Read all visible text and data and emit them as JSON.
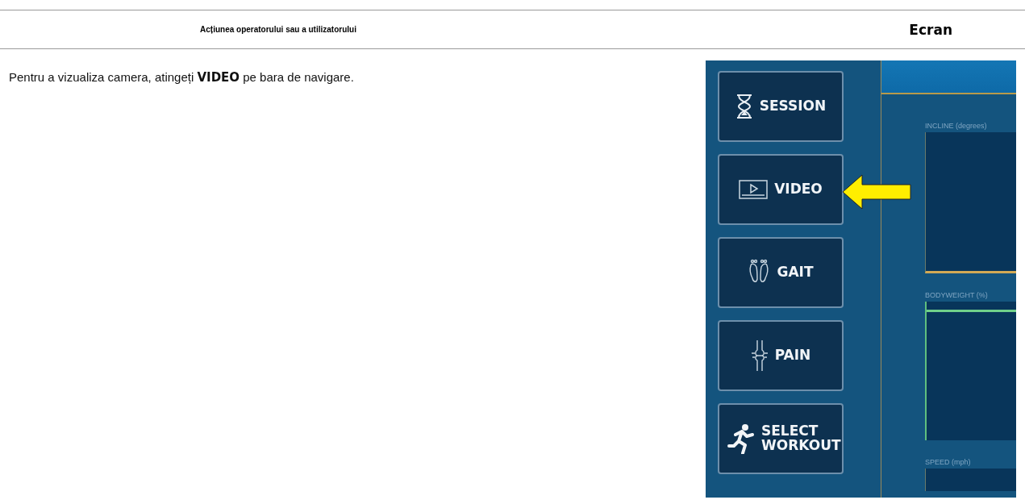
{
  "table": {
    "columns": [
      "Acțiunea operatorului sau a utilizatorului",
      "Ecran"
    ],
    "rows": [
      {
        "action": "Pentru a vizualiza camera, atingeți **VIDEO** pe bara de navigare.",
        "screen": {
          "nav_items": [
            {
              "label": "SESSION"
            },
            {
              "label": "VIDEO"
            },
            {
              "label": "GAIT"
            },
            {
              "label": "PAIN"
            },
            {
              "label": "SELECT WORKOUT"
            }
          ],
          "panels": [
            {
              "label": "INCLINE (degrees)"
            },
            {
              "label": "BODYWEIGHT (%)"
            },
            {
              "label": "SPEED (mph)"
            }
          ]
        }
      }
    ]
  }
}
